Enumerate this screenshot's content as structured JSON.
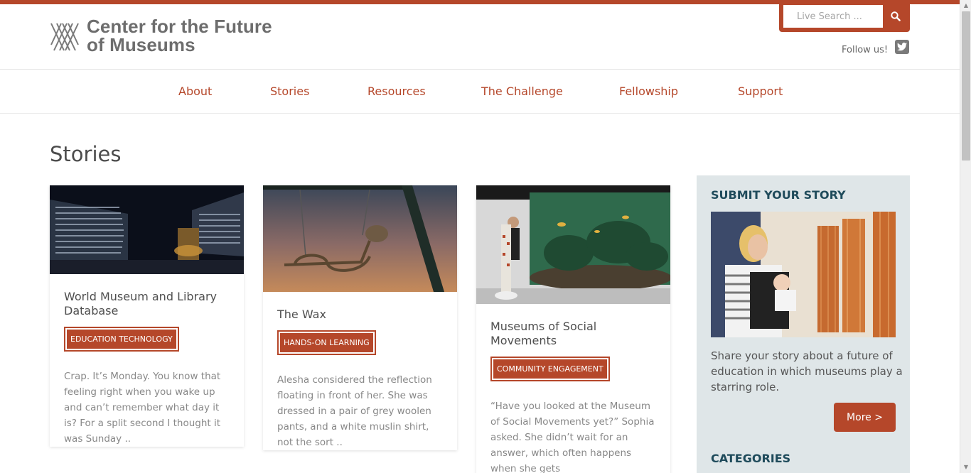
{
  "site": {
    "logo_line1": "Center for the Future",
    "logo_line2": "of Museums"
  },
  "search": {
    "placeholder": "Live Search ..."
  },
  "social": {
    "follow_label": "Follow us!"
  },
  "nav": {
    "items": [
      "About",
      "Stories",
      "Resources",
      "The Challenge",
      "Fellowship",
      "Support"
    ]
  },
  "page": {
    "title": "Stories"
  },
  "cards": [
    {
      "title": "World Museum and Library Database",
      "tag": "EDUCATION TECHNOLOGY",
      "excerpt": "Crap.  It’s Monday. You know that feeling right when you wake up and can’t remember what day it is?  For a split second I thought it was Sunday .."
    },
    {
      "title": "The Wax",
      "tag": "HANDS-ON LEARNING",
      "excerpt": "Alesha considered the reflection floating in front of her. She was dressed in a pair of grey woolen pants, and a white muslin shirt, not the sort .."
    },
    {
      "title": "Museums of Social Movements",
      "tag": "COMMUNITY ENGAGEMENT",
      "excerpt": "“Have you looked at the Museum of Social Movements yet?” Sophia asked. She didn’t wait for an answer, which often happens when she gets"
    }
  ],
  "sidebar": {
    "submit_title": "SUBMIT YOUR STORY",
    "submit_text": "Share your story about a future of education in which museums play a starring role.",
    "more_label": "More >",
    "categories_title": "CATEGORIES"
  },
  "colors": {
    "accent": "#b5472a",
    "sidebar_bg": "#dfe6e8",
    "sidebar_heading": "#1f4b5b"
  }
}
